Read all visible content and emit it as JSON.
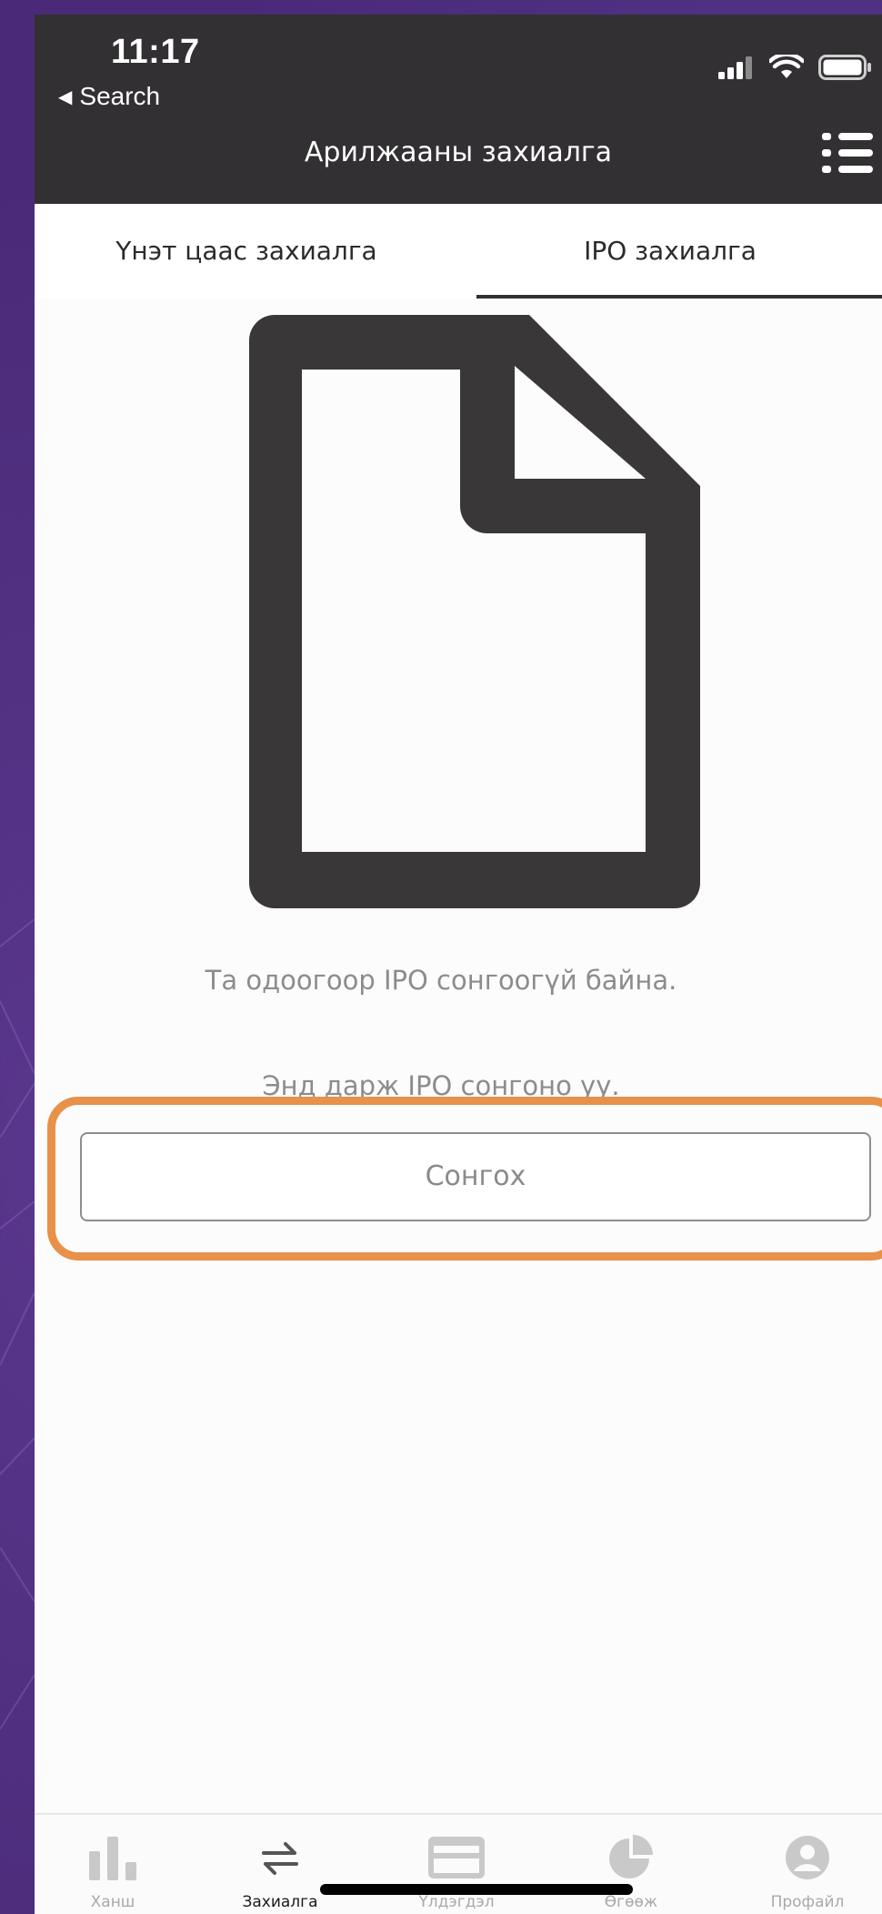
{
  "status_bar": {
    "time": "11:17",
    "back_label": "Search"
  },
  "header": {
    "title": "Арилжааны захиалга"
  },
  "tabs": [
    {
      "label": "Үнэт цаас захиалга",
      "active": false
    },
    {
      "label": "IPO захиалга",
      "active": true
    }
  ],
  "empty_state": {
    "icon": "document-icon",
    "message": "Та одоогоор IPO сонгоогүй байна.",
    "hint": "Энд дарж IPO сонгоно уу.",
    "button_label": "Сонгох"
  },
  "bottom_nav": [
    {
      "label": "Ханш",
      "icon": "bar-chart-icon",
      "active": false
    },
    {
      "label": "Захиалга",
      "icon": "swap-arrows-icon",
      "active": true
    },
    {
      "label": "Үлдэгдэл",
      "icon": "card-icon",
      "active": false
    },
    {
      "label": "Өгөөж",
      "icon": "pie-chart-icon",
      "active": false
    },
    {
      "label": "Профайл",
      "icon": "profile-icon",
      "active": false
    }
  ],
  "colors": {
    "header_bg": "#323032",
    "highlight": "#e8914a",
    "background": "#4a2a78"
  }
}
